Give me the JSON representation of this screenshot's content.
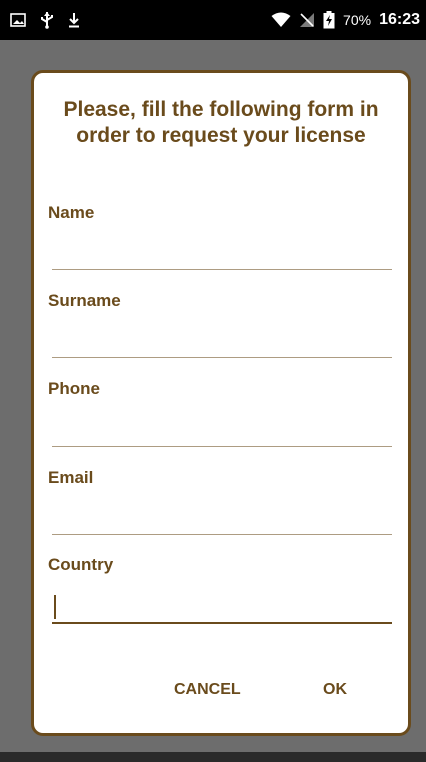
{
  "status_bar": {
    "battery_text": "70%",
    "time": "16:23",
    "icons": {
      "left": [
        "image-icon",
        "usb-icon",
        "download-icon"
      ],
      "right": [
        "wifi-icon",
        "no-sim-icon",
        "battery-charging-icon"
      ]
    }
  },
  "dialog": {
    "title": "Please, fill the following form in order to request your license",
    "fields": {
      "name": {
        "label": "Name",
        "value": ""
      },
      "surname": {
        "label": "Surname",
        "value": ""
      },
      "phone": {
        "label": "Phone",
        "value": ""
      },
      "email": {
        "label": "Email",
        "value": ""
      },
      "country": {
        "label": "Country",
        "value": ""
      }
    },
    "buttons": {
      "cancel": "CANCEL",
      "ok": "OK"
    }
  },
  "colors": {
    "accent": "#6a4b1c",
    "background_dim": "#6d6d6d",
    "status_bar": "#000000",
    "dialog_bg": "#ffffff"
  }
}
